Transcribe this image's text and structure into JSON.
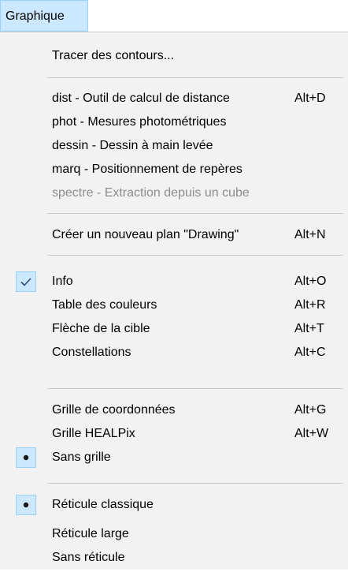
{
  "menubar": {
    "title": "Graphique"
  },
  "menu": {
    "trace_contours": {
      "label": "Tracer des contours..."
    },
    "dist": {
      "label": "dist - Outil de calcul de distance",
      "shortcut": "Alt+D"
    },
    "phot": {
      "label": "phot -  Mesures photométriques"
    },
    "dessin": {
      "label": "dessin - Dessin à main levée"
    },
    "marq": {
      "label": "marq -  Positionnement de repères"
    },
    "spectre": {
      "label": "spectre - Extraction depuis un cube",
      "enabled": false
    },
    "new_drawing": {
      "label": "Créer un nouveau plan \"Drawing\"",
      "shortcut": "Alt+N"
    },
    "info": {
      "label": "Info",
      "shortcut": "Alt+O",
      "checked": true,
      "mark": "check-icon"
    },
    "color_table": {
      "label": "Table des couleurs",
      "shortcut": "Alt+R"
    },
    "target_arrow": {
      "label": "Flèche de la cible",
      "shortcut": "Alt+T"
    },
    "constellations": {
      "label": "Constellations",
      "shortcut": "Alt+C"
    },
    "coord_grid": {
      "label": "Grille de coordonnées",
      "shortcut": "Alt+G"
    },
    "healpix_grid": {
      "label": "Grille HEALPix",
      "shortcut": "Alt+W"
    },
    "no_grid": {
      "label": "Sans grille",
      "selected": true,
      "mark": "radio-dot-icon"
    },
    "reticle_classic": {
      "label": "Réticule classique",
      "selected": true,
      "mark": "radio-dot-icon"
    },
    "reticle_large": {
      "label": "Réticule large"
    },
    "no_reticle": {
      "label": "Sans réticule"
    }
  },
  "colors": {
    "highlight_fill": "#cce8ff",
    "highlight_border": "#99d1ff",
    "menu_background": "#f2f2f2",
    "disabled_text": "#8c8c8c"
  }
}
